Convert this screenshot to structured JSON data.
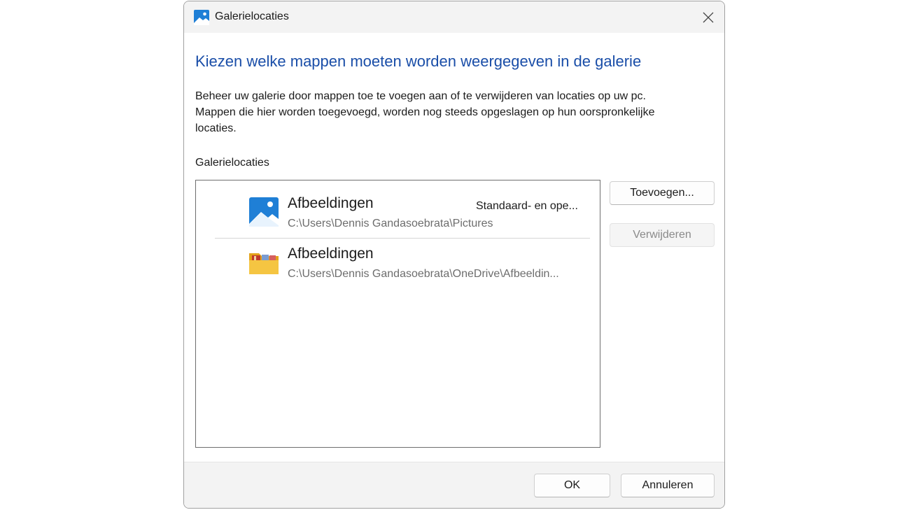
{
  "window": {
    "title": "Galerielocaties",
    "icon": "gallery-icon"
  },
  "heading": "Kiezen welke mappen moeten worden weergegeven in de galerie",
  "description": [
    "Beheer uw galerie door mappen toe te voegen aan of te verwijderen van locaties op uw pc.",
    "Mappen die hier worden toegevoegd, worden nog steeds opgeslagen op hun oorspronkelijke",
    "locaties."
  ],
  "list_label": "Galerielocaties",
  "locations": [
    {
      "name": "Afbeeldingen",
      "path": "C:\\Users\\Dennis Gandasoebrata\\Pictures",
      "tag": "Standaard- en ope...",
      "icon": "pictures-library-icon"
    },
    {
      "name": "Afbeeldingen",
      "path": "C:\\Users\\Dennis Gandasoebrata\\OneDrive\\Afbeeldin...",
      "tag": "",
      "icon": "folder-icon"
    }
  ],
  "buttons": {
    "add": "Toevoegen...",
    "remove": "Verwijderen",
    "ok": "OK",
    "cancel": "Annuleren"
  },
  "colors": {
    "heading": "#1a4ea8",
    "accent": "#1f7fd6",
    "folder": "#f5c542"
  }
}
